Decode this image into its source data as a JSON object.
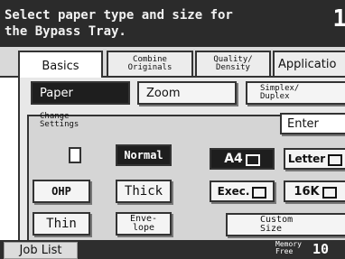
{
  "header": {
    "line1": "Select paper type and size for",
    "line2": "the Bypass Tray.",
    "page_indicator": "1"
  },
  "tabs": {
    "basics": "Basics",
    "combine_1": "Combine",
    "combine_2": "Originals",
    "quality_1": "Quality/",
    "quality_2": "Density",
    "application": "Applicatio"
  },
  "subtabs": {
    "paper": "Paper",
    "zoom": "Zoom",
    "simplex_1": "Simplex/",
    "simplex_2": "Duplex"
  },
  "change_settings_1": "Change",
  "change_settings_2": "Settings",
  "enter": "Enter",
  "types": {
    "normal": "Normal",
    "ohp": "OHP",
    "thick": "Thick",
    "thin": "Thin",
    "envelope_1": "Enve-",
    "envelope_2": "lope"
  },
  "sizes": {
    "a4": "A4",
    "letter": "Letter",
    "exec": "Exec.",
    "k16": "16K",
    "custom_1": "Custom",
    "custom_2": "Size"
  },
  "footer": {
    "job_list": "Job List",
    "memory_1": "Memory",
    "memory_2": "Free",
    "memory_value": "10"
  },
  "selected": {
    "type": "Normal",
    "size": "A4"
  }
}
